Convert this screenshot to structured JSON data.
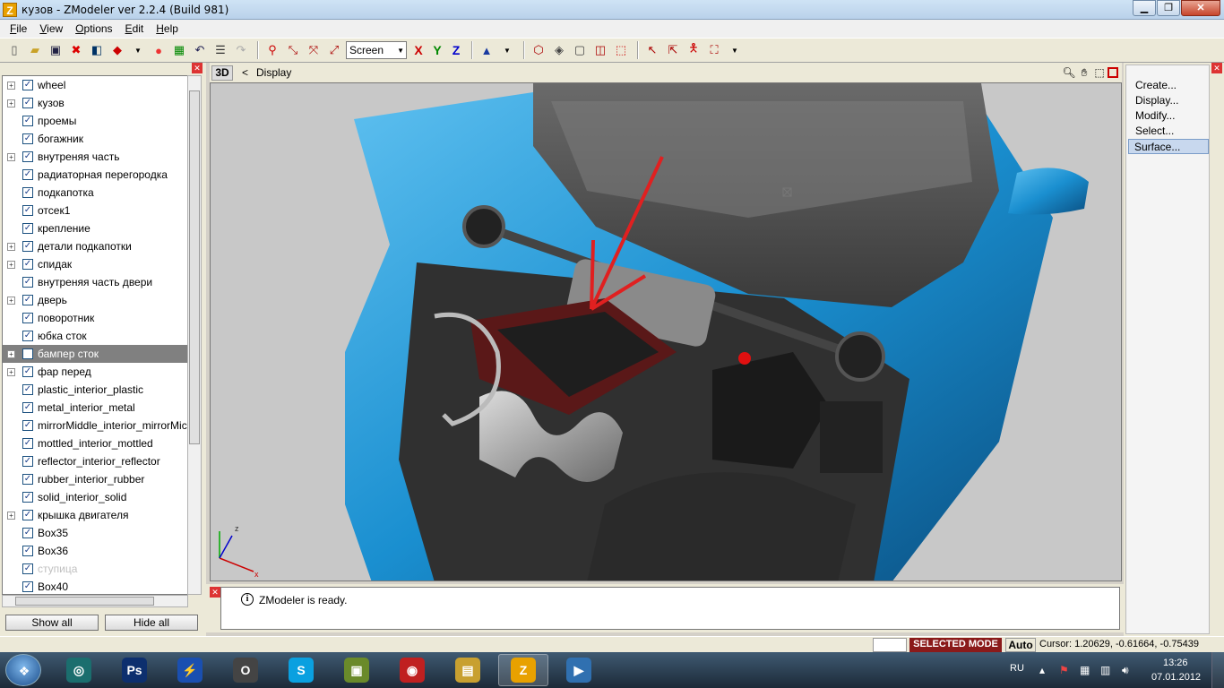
{
  "window": {
    "title": "кузов - ZModeler ver 2.2.4 (Build 981)",
    "app_icon_letter": "Z"
  },
  "menu": [
    {
      "label": "File",
      "u": "F",
      "rest": "ile"
    },
    {
      "label": "View",
      "u": "V",
      "rest": "iew"
    },
    {
      "label": "Options",
      "u": "O",
      "rest": "ptions"
    },
    {
      "label": "Edit",
      "u": "E",
      "rest": "dit"
    },
    {
      "label": "Help",
      "u": "H",
      "rest": "elp"
    }
  ],
  "toolbar": {
    "coord_mode": "Screen",
    "axis_x": "X",
    "axis_y": "Y",
    "axis_z": "Z"
  },
  "tree": {
    "items": [
      {
        "label": "wheel",
        "expander": true,
        "checked": true
      },
      {
        "label": "кузов",
        "expander": true,
        "checked": true
      },
      {
        "label": "проемы",
        "expander": false,
        "checked": true
      },
      {
        "label": "богажник",
        "expander": false,
        "checked": true
      },
      {
        "label": "внутреняя часть",
        "expander": true,
        "checked": true
      },
      {
        "label": "радиаторная перегородка",
        "expander": false,
        "checked": true
      },
      {
        "label": "подкапотка",
        "expander": false,
        "checked": true
      },
      {
        "label": "отсек1",
        "expander": false,
        "checked": true
      },
      {
        "label": "крепление",
        "expander": false,
        "checked": true
      },
      {
        "label": "детали подкапотки",
        "expander": true,
        "checked": true
      },
      {
        "label": "спидак",
        "expander": true,
        "checked": true
      },
      {
        "label": "внутреняя часть двери",
        "expander": false,
        "checked": true
      },
      {
        "label": "дверь",
        "expander": true,
        "checked": true
      },
      {
        "label": "поворотник",
        "expander": false,
        "checked": true
      },
      {
        "label": "юбка сток",
        "expander": false,
        "checked": true
      },
      {
        "label": "бампер сток",
        "expander": true,
        "checked": false,
        "highlighted": true
      },
      {
        "label": "фар перед",
        "expander": true,
        "checked": true
      },
      {
        "label": "plastic_interior_plastic",
        "expander": false,
        "checked": true
      },
      {
        "label": "metal_interior_metal",
        "expander": false,
        "checked": true
      },
      {
        "label": "mirrorMiddle_interior_mirrorMic",
        "expander": false,
        "checked": true
      },
      {
        "label": "mottled_interior_mottled",
        "expander": false,
        "checked": true
      },
      {
        "label": "reflector_interior_reflector",
        "expander": false,
        "checked": true
      },
      {
        "label": "rubber_interior_rubber",
        "expander": false,
        "checked": true
      },
      {
        "label": "solid_interior_solid",
        "expander": false,
        "checked": true
      },
      {
        "label": "крышка двигателя",
        "expander": true,
        "checked": true
      },
      {
        "label": "Box35",
        "expander": false,
        "checked": true
      },
      {
        "label": "Box36",
        "expander": false,
        "checked": true
      },
      {
        "label": "ступица",
        "expander": false,
        "checked": true,
        "faded": true
      },
      {
        "label": "Box40",
        "expander": false,
        "checked": true
      }
    ],
    "show_all": "Show all",
    "hide_all": "Hide all"
  },
  "viewport": {
    "mode_badge": "3D",
    "back_glyph": "<",
    "label": "Display",
    "axis_z": "z",
    "axis_x": "x"
  },
  "commands": [
    {
      "label": "Create..."
    },
    {
      "label": "Display..."
    },
    {
      "label": "Modify..."
    },
    {
      "label": "Select..."
    },
    {
      "label": "Surface...",
      "selected": true
    }
  ],
  "log": {
    "message": "ZModeler is ready."
  },
  "status": {
    "mode": "SELECTED MODE",
    "auto": "Auto",
    "cursor": "Cursor: 1.20629, -0.61664, -0.75439"
  },
  "taskbar": {
    "lang": "RU",
    "time": "13:26",
    "date": "07.01.2012",
    "apps": [
      {
        "name": "task-app-1",
        "glyph": "◎"
      },
      {
        "name": "task-photoshop",
        "glyph": "Ps"
      },
      {
        "name": "task-app-3",
        "glyph": "⚡"
      },
      {
        "name": "task-opera",
        "glyph": "O"
      },
      {
        "name": "task-skype",
        "glyph": "S"
      },
      {
        "name": "task-app-6",
        "glyph": "▣"
      },
      {
        "name": "task-app-7",
        "glyph": "◉"
      },
      {
        "name": "task-explorer",
        "glyph": "▤"
      },
      {
        "name": "task-zmodeler",
        "glyph": "Z",
        "active": true
      },
      {
        "name": "task-media",
        "glyph": "▶"
      }
    ]
  },
  "colors": {
    "car_body": "#1a8fd0",
    "selected_mode_bg": "#8a1a1a",
    "annotation_arrow": "#e02020"
  }
}
